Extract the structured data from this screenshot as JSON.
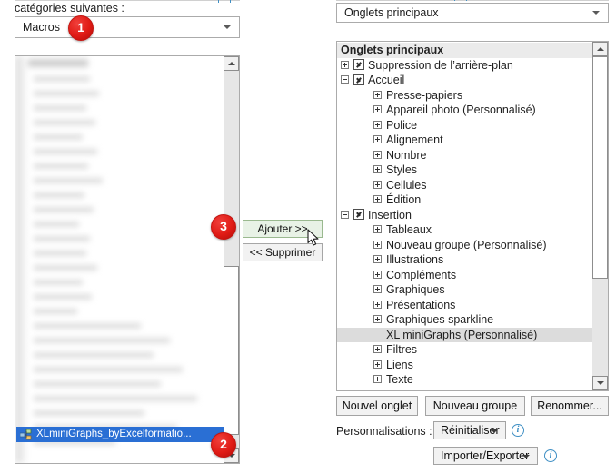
{
  "left": {
    "label": "catégories suivantes :",
    "category_combo": {
      "value": "Macros",
      "icon": "chevron-down-icon"
    },
    "selected_macro": "XLminiGraphs_byExcelformatio...",
    "macro_icon": "module-icon"
  },
  "middle": {
    "add_button": "Ajouter >>",
    "add_button_accel": "A",
    "remove_button": "<< Supprimer",
    "remove_button_accel": "S",
    "cursor": "mouse-pointer"
  },
  "right": {
    "tabs_combo": {
      "value": "Onglets principaux",
      "icon": "chevron-down-icon"
    },
    "tree_header": "Onglets principaux",
    "tree": [
      {
        "label": "Onglets principaux",
        "indent": 0,
        "type": "header"
      },
      {
        "label": "Suppression de l’arrière-plan",
        "indent": 1,
        "expander": "plus",
        "checked": true
      },
      {
        "label": "Accueil",
        "indent": 1,
        "expander": "minus",
        "checked": true
      },
      {
        "label": "Presse-papiers",
        "indent": 2,
        "expander": "plus"
      },
      {
        "label": "Appareil photo (Personnalisé)",
        "indent": 2,
        "expander": "plus"
      },
      {
        "label": "Police",
        "indent": 2,
        "expander": "plus"
      },
      {
        "label": "Alignement",
        "indent": 2,
        "expander": "plus"
      },
      {
        "label": "Nombre",
        "indent": 2,
        "expander": "plus"
      },
      {
        "label": "Styles",
        "indent": 2,
        "expander": "plus"
      },
      {
        "label": "Cellules",
        "indent": 2,
        "expander": "plus"
      },
      {
        "label": "Édition",
        "indent": 2,
        "expander": "plus"
      },
      {
        "label": "Insertion",
        "indent": 1,
        "expander": "minus",
        "checked": true
      },
      {
        "label": "Tableaux",
        "indent": 2,
        "expander": "plus"
      },
      {
        "label": "Nouveau groupe (Personnalisé)",
        "indent": 2,
        "expander": "plus"
      },
      {
        "label": "Illustrations",
        "indent": 2,
        "expander": "plus"
      },
      {
        "label": "Compléments",
        "indent": 2,
        "expander": "plus"
      },
      {
        "label": "Graphiques",
        "indent": 2,
        "expander": "plus"
      },
      {
        "label": "Présentations",
        "indent": 2,
        "expander": "plus"
      },
      {
        "label": "Graphiques sparkline",
        "indent": 2,
        "expander": "plus"
      },
      {
        "label": "XL miniGraphs (Personnalisé)",
        "indent": 2,
        "selected": true
      },
      {
        "label": "Filtres",
        "indent": 2,
        "expander": "plus"
      },
      {
        "label": "Liens",
        "indent": 2,
        "expander": "plus"
      },
      {
        "label": "Texte",
        "indent": 2,
        "expander": "plus"
      }
    ],
    "buttons": {
      "new_tab": "Nouvel onglet",
      "new_tab_accel": "t",
      "new_group": "Nouveau groupe",
      "new_group_accel": "N",
      "rename": "Renommer...",
      "rename_accel": "m"
    },
    "customizations_label": "Personnalisations :",
    "reset_button": "Réinitialiser",
    "reset_accel": "R",
    "import_export_button": "Importer/Exporter",
    "import_export_accel": "p"
  },
  "badges": [
    {
      "number": "1"
    },
    {
      "number": "2"
    },
    {
      "number": "3"
    }
  ],
  "colors": {
    "badge_red": "#e01b15",
    "selection_blue": "#2a6fd4",
    "tree_selection_gray": "#dcdcdc",
    "info_blue": "#3f8fc4"
  }
}
